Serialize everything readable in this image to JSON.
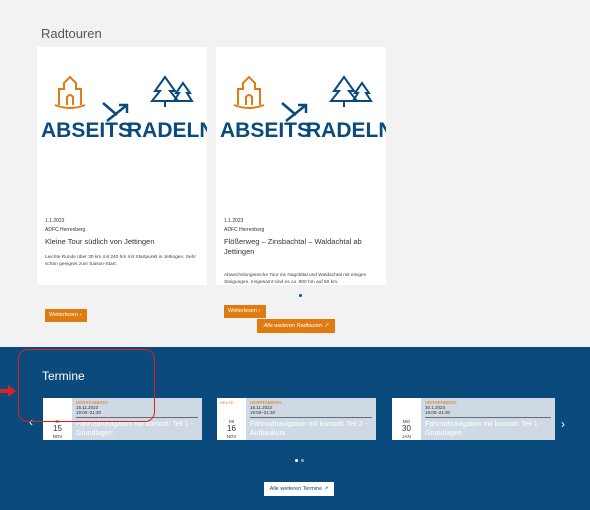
{
  "tours": {
    "heading": "Radtouren",
    "cards": [
      {
        "logo_left": "ABSEITS",
        "logo_right": "RADELN",
        "date": "1.1.2023",
        "org": "ADFC Herrenberg",
        "title": "Kleine Tour südlich von Jettingen",
        "description": "Leichte Runde über 30 km mit 240 hm mit Startpunkt in Jettingen. Sehr schön geeignet zum Saison-Start.",
        "button": "Weiterlesen"
      },
      {
        "logo_left": "ABSEITS",
        "logo_right": "RADELN",
        "date": "1.1.2023",
        "org": "ADFC Herrenberg",
        "title": "Flößerweg – Zinsbachtal – Waldachtal ab Jettingen",
        "description": "Abwechslungsreiche Tour ins Nagoldtal und Waldachtal mit einigen Steigungen. Insgesamt sind es ca. 900 hm auf 60 km.",
        "button": "Weiterlesen"
      }
    ],
    "all_button": "Alle weiteren Radtouren"
  },
  "events": {
    "heading": "Termine",
    "items": [
      {
        "today_label": "",
        "weekday": "Di",
        "day": "15",
        "month": "NOV",
        "org": "HERRENBERG",
        "date": "15.11.2022",
        "time": "19:00–21:30",
        "title": "Fahrradnavigation mit komoot: Teil 1 - Grundlagen"
      },
      {
        "today_label": "HEUTE",
        "weekday": "MI",
        "day": "16",
        "month": "NOV",
        "org": "HERRENBERG",
        "date": "16.11.2022",
        "time": "19:00–21:30",
        "title": "Fahrradnavigation mit komoot: Teil 2 - Aufbaukurs"
      },
      {
        "today_label": "",
        "weekday": "MO",
        "day": "30",
        "month": "JAN",
        "org": "HERRENBERG",
        "date": "30.1.2023",
        "time": "19:00–21:30",
        "title": "Fahrradnavigation mit komoot: Teil 1 - Grundlagen"
      }
    ],
    "prev_label": "‹",
    "next_label": "›",
    "all_button": "Alle weiteren Termine"
  },
  "colors": {
    "accent": "#e07b12",
    "section_blue": "#0a4a7d",
    "highlight": "#e02020"
  },
  "icons": {
    "external": "external-link-icon",
    "chevron": "chevron-right-icon"
  }
}
